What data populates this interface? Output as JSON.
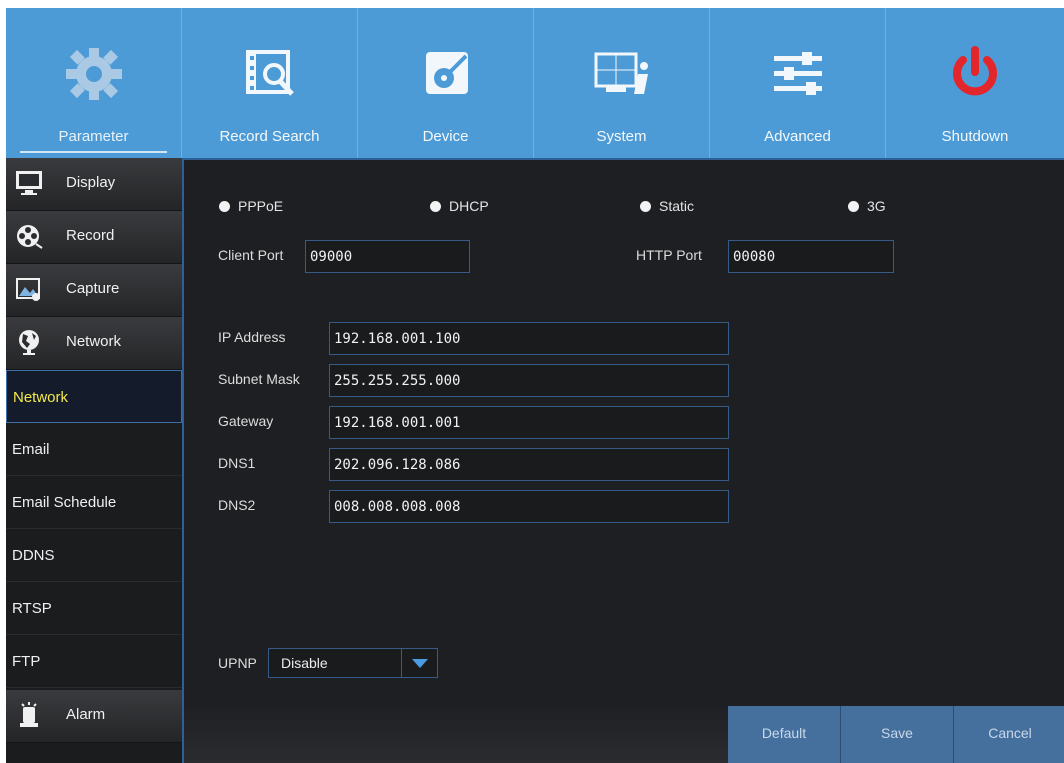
{
  "top_tabs": [
    {
      "label": "Parameter",
      "icon": "gear-icon",
      "active": true
    },
    {
      "label": "Record Search",
      "icon": "record-search-icon"
    },
    {
      "label": "Device",
      "icon": "device-icon"
    },
    {
      "label": "System",
      "icon": "system-icon"
    },
    {
      "label": "Advanced",
      "icon": "advanced-icon"
    },
    {
      "label": "Shutdown",
      "icon": "power-icon"
    }
  ],
  "sidebar": {
    "sections_before": [
      {
        "label": "Display",
        "icon": "monitor-icon"
      },
      {
        "label": "Record",
        "icon": "film-reel-icon"
      },
      {
        "label": "Capture",
        "icon": "picture-icon"
      },
      {
        "label": "Network",
        "icon": "globe-icon"
      }
    ],
    "sub_items": [
      "Network",
      "Email",
      "Email Schedule",
      "DDNS",
      "RTSP",
      "FTP"
    ],
    "active_sub": "Network",
    "sections_after": [
      {
        "label": "Alarm",
        "icon": "alarm-icon"
      }
    ]
  },
  "network": {
    "modes": [
      "PPPoE",
      "DHCP",
      "Static",
      "3G"
    ],
    "client_port_label": "Client Port",
    "client_port": "09000",
    "http_port_label": "HTTP Port",
    "http_port": "00080",
    "ip_address_label": "IP Address",
    "ip_address": "192.168.001.100",
    "subnet_mask_label": "Subnet Mask",
    "subnet_mask": "255.255.255.000",
    "gateway_label": "Gateway",
    "gateway": "192.168.001.001",
    "dns1_label": "DNS1",
    "dns1": "202.096.128.086",
    "dns2_label": "DNS2",
    "dns2": "008.008.008.008",
    "upnp_label": "UPNP",
    "upnp_value": "Disable"
  },
  "buttons": {
    "default": "Default",
    "save": "Save",
    "cancel": "Cancel"
  },
  "colors": {
    "topbar": "#4d9bd6",
    "panel_border": "#2e5f96",
    "active_text": "#f4e94a",
    "shutdown": "#e3262b"
  }
}
